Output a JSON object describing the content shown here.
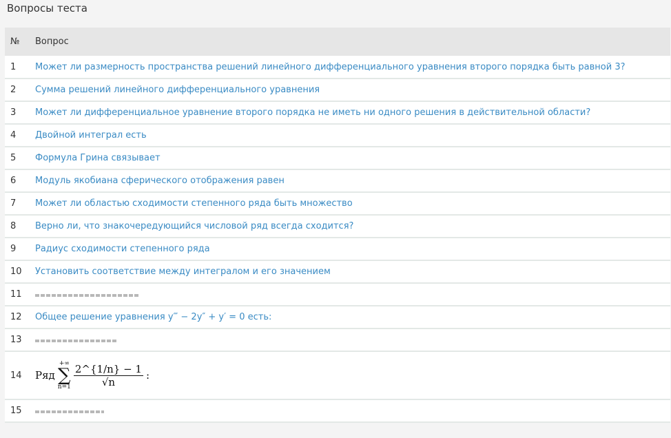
{
  "title": "Вопросы теста",
  "headers": {
    "num": "№",
    "question": "Вопрос"
  },
  "colors": {
    "link": "#3a8bc4"
  },
  "rows": [
    {
      "n": "1",
      "q": "Может ли размерность пространства решений линейного дифференциального уравнения второго порядка быть равной 3?"
    },
    {
      "n": "2",
      "q": "Сумма решений линейного дифференциального уравнения"
    },
    {
      "n": "3",
      "q": "Может ли дифференциальное уравнение второго порядка не иметь ни одного решения в действительной области?"
    },
    {
      "n": "4",
      "q": "Двойной интеграл есть"
    },
    {
      "n": "5",
      "q": "Формула Грина связывает"
    },
    {
      "n": "6",
      "q": "Модуль якобиана сферического отображения равен"
    },
    {
      "n": "7",
      "q": "Может ли областью сходимости степенного ряда быть множество"
    },
    {
      "n": "8",
      "q": "Верно ли, что знакочередующийся числовой ряд всегда сходится?"
    },
    {
      "n": "9",
      "q": "Радиус сходимости степенного ряда"
    },
    {
      "n": "10",
      "q": "Установить соответствие между интегралом и его значением"
    },
    {
      "n": "11"
    },
    {
      "n": "12",
      "q": "Общее решение уравнения y‴ − 2y″ + y′ = 0 есть:"
    },
    {
      "n": "13"
    },
    {
      "n": "14",
      "formula": {
        "word": "Ряд",
        "upper": "+∞",
        "sigma": "∑",
        "lower": "n=1",
        "numerator": "2^{1/n} − 1",
        "denominator": "√n",
        "tail": ":"
      }
    },
    {
      "n": "15"
    }
  ]
}
